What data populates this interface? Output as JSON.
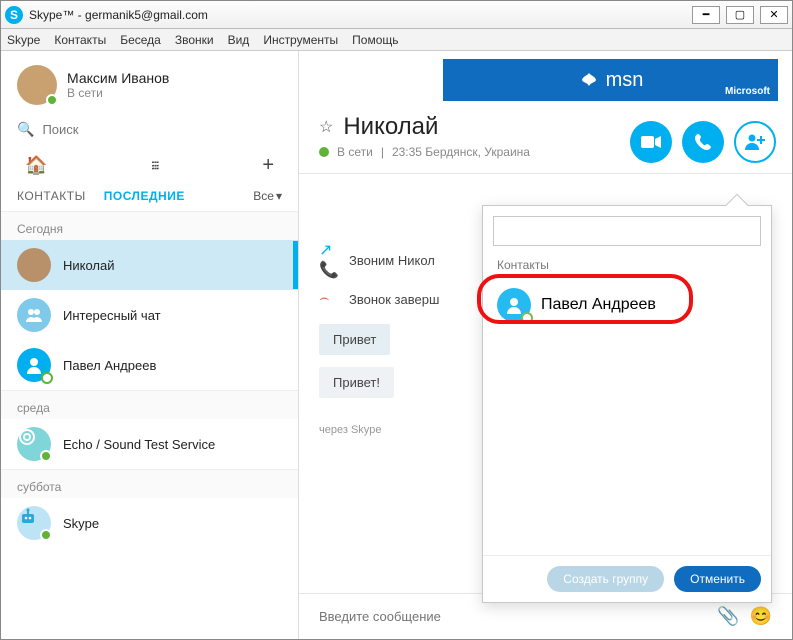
{
  "window": {
    "title": "Skype™ - germanik5@gmail.com"
  },
  "menu": [
    "Skype",
    "Контакты",
    "Беседа",
    "Звонки",
    "Вид",
    "Инструменты",
    "Помощь"
  ],
  "profile": {
    "name": "Максим Иванов",
    "status": "В сети"
  },
  "search": {
    "placeholder": "Поиск"
  },
  "tabs": {
    "contacts": "КОНТАКТЫ",
    "recent": "ПОСЛЕДНИЕ",
    "filter": "Все"
  },
  "sections": {
    "today": "Сегодня",
    "wednesday": "среда",
    "saturday": "суббота"
  },
  "recent": [
    {
      "label": "Николай",
      "selected": true,
      "avatar": "photo1"
    },
    {
      "label": "Интересный чат",
      "avatar": "group"
    },
    {
      "label": "Павел Андреев",
      "avatar": "photo2"
    }
  ],
  "wed": [
    {
      "label": "Echo / Sound Test Service",
      "avatar": "echo"
    }
  ],
  "sat": [
    {
      "label": "Skype",
      "avatar": "robot"
    }
  ],
  "banner": {
    "brand": "msn",
    "vendor": "Microsoft"
  },
  "conversation": {
    "title": "Николай",
    "status": "В сети",
    "meta": "23:35 Бердянск, Украина",
    "calling": "Звоним Никол",
    "ended": "Звонок заверш",
    "bubble1": "Привет",
    "bubble2": "Привет!",
    "via": "через Skype",
    "composer_placeholder": "Введите сообщение"
  },
  "popup": {
    "section": "Контакты",
    "contact": "Павел Андреев",
    "create": "Создать группу",
    "cancel": "Отменить"
  }
}
